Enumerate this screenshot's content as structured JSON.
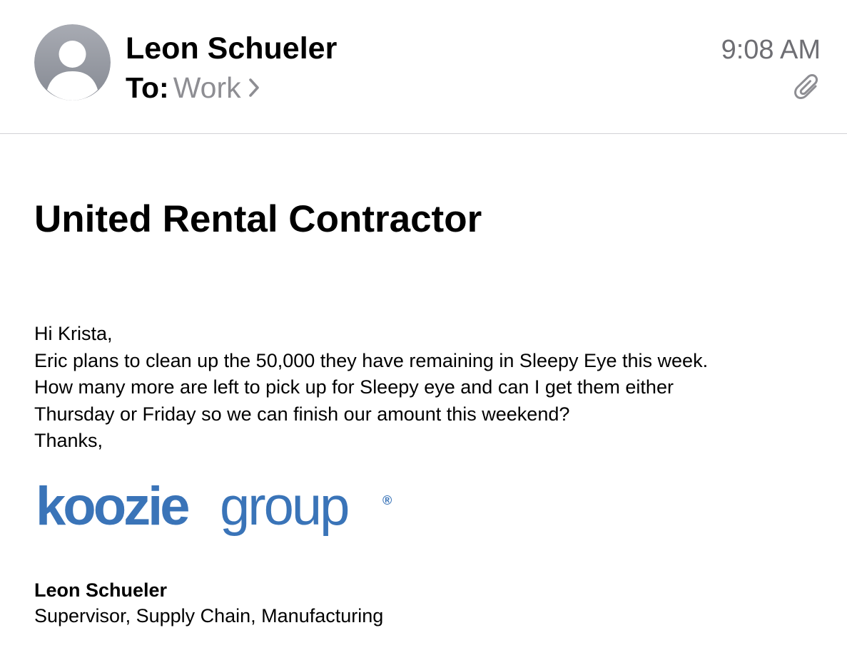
{
  "header": {
    "sender_name": "Leon Schueler",
    "to_label": "To:",
    "recipient": "Work",
    "time": "9:08 AM",
    "avatar_icon": "person-silhouette-icon",
    "attachment_icon": "paperclip-icon",
    "chevron_icon": "chevron-right-icon"
  },
  "email": {
    "subject": "United Rental Contractor",
    "body_lines": [
      "Hi Krista,",
      "Eric plans to clean up the 50,000 they have remaining in Sleepy Eye this week.",
      "How many more are left to pick up for Sleepy eye and can I get them either",
      "Thursday or Friday so we can finish our amount this weekend?",
      "Thanks,"
    ]
  },
  "signature": {
    "logo_text_bold": "koozie",
    "logo_text_light": "group",
    "logo_registered": "®",
    "name": "Leon Schueler",
    "title": "Supervisor, Supply Chain, Manufacturing"
  },
  "colors": {
    "secondary_text": "#8e8e93",
    "time_text": "#6e6e73",
    "brand_blue": "#3a74b8",
    "divider": "#d1d1d6"
  }
}
